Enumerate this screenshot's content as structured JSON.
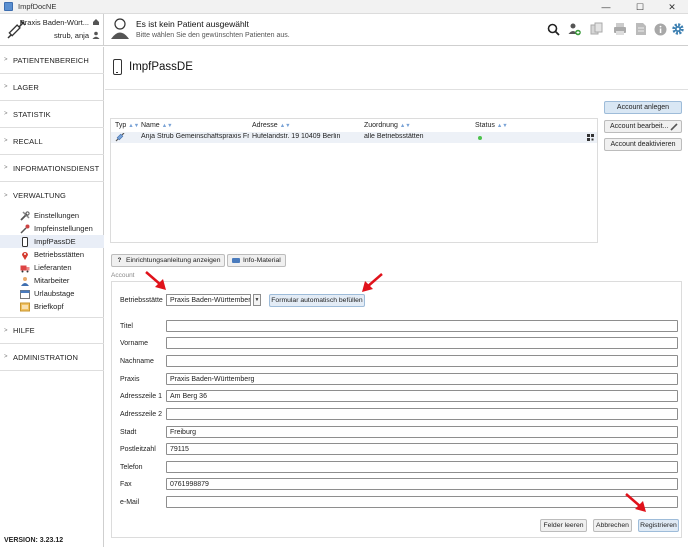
{
  "window": {
    "title": "ImpfDocNE",
    "min": "—",
    "max": "☐",
    "close": "✕"
  },
  "header": {
    "practice_name": "Praxis Baden-Würt...",
    "user_name": "strub, anja",
    "patient_title": "Es ist kein Patient ausgewählt",
    "patient_subtitle": "Bitte wählen Sie den gewünschten Patienten aus.",
    "toolbar_icons": [
      "search-icon",
      "add-patient-icon",
      "copy-icon",
      "print-icon",
      "document-icon",
      "info-icon",
      "gear-icon"
    ],
    "accent": "#3c7fb1"
  },
  "sidebar": {
    "items": [
      {
        "label": "PATIENTENBEREICH"
      },
      {
        "label": "LAGER"
      },
      {
        "label": "STATISTIK"
      },
      {
        "label": "RECALL"
      },
      {
        "label": "INFORMATIONSDIENST"
      },
      {
        "label": "VERWALTUNG"
      }
    ],
    "sub_items": [
      {
        "label": "Einstellungen",
        "icon": "tools-icon"
      },
      {
        "label": "Impfeinstellungen",
        "icon": "syringe-settings-icon"
      },
      {
        "label": "ImpfPassDE",
        "icon": "phone-icon",
        "active": true
      },
      {
        "label": "Betriebsstätten",
        "icon": "location-pin-icon"
      },
      {
        "label": "Lieferanten",
        "icon": "truck-icon"
      },
      {
        "label": "Mitarbeiter",
        "icon": "staff-icon"
      },
      {
        "label": "Urlaubstage",
        "icon": "calendar-icon"
      },
      {
        "label": "Briefkopf",
        "icon": "letterhead-icon"
      }
    ],
    "bottom_items": [
      {
        "label": "HILFE"
      },
      {
        "label": "ADMINISTRATION"
      }
    ],
    "version": "VERSION: 3.23.12"
  },
  "main": {
    "title": "ImpfPassDE",
    "table": {
      "headers": [
        "Typ",
        "Name",
        "Adresse",
        "Zuordnung",
        "Status"
      ],
      "rows": [
        {
          "name": "Anja Strub Gemeinschaftspraxis Fr...",
          "address": "Hufelandstr. 19 10409 Berlin",
          "assignment": "alle Betriebsstätten",
          "status_color": "#4cc24c"
        }
      ]
    },
    "actions": {
      "create": "Account anlegen",
      "edit": "Account bearbeit...",
      "deactivate": "Account deaktivieren"
    },
    "help_button": "Einrichtungsanleitung anzeigen",
    "info_button": "Info-Material",
    "section_label": "Account",
    "form": {
      "site_label": "Betriebsstätte",
      "site_value": "Praxis Baden-Württemberg",
      "autofill_button": "Formular automatisch befüllen",
      "fields": [
        {
          "label": "Titel",
          "value": ""
        },
        {
          "label": "Vorname",
          "value": ""
        },
        {
          "label": "Nachname",
          "value": ""
        },
        {
          "label": "Praxis",
          "value": "Praxis Baden-Württemberg"
        },
        {
          "label": "Adresszeile 1",
          "value": "Am Berg 36"
        },
        {
          "label": "Adresszeile 2",
          "value": ""
        },
        {
          "label": "Stadt",
          "value": "Freiburg"
        },
        {
          "label": "Postleitzahl",
          "value": "79115"
        },
        {
          "label": "Telefon",
          "value": ""
        },
        {
          "label": "Fax",
          "value": "0761998879"
        },
        {
          "label": "e-Mail",
          "value": ""
        }
      ],
      "clear_button": "Felder leeren",
      "cancel_button": "Abbrechen",
      "register_button": "Registrieren"
    },
    "annotation_color": "#e0121b"
  }
}
